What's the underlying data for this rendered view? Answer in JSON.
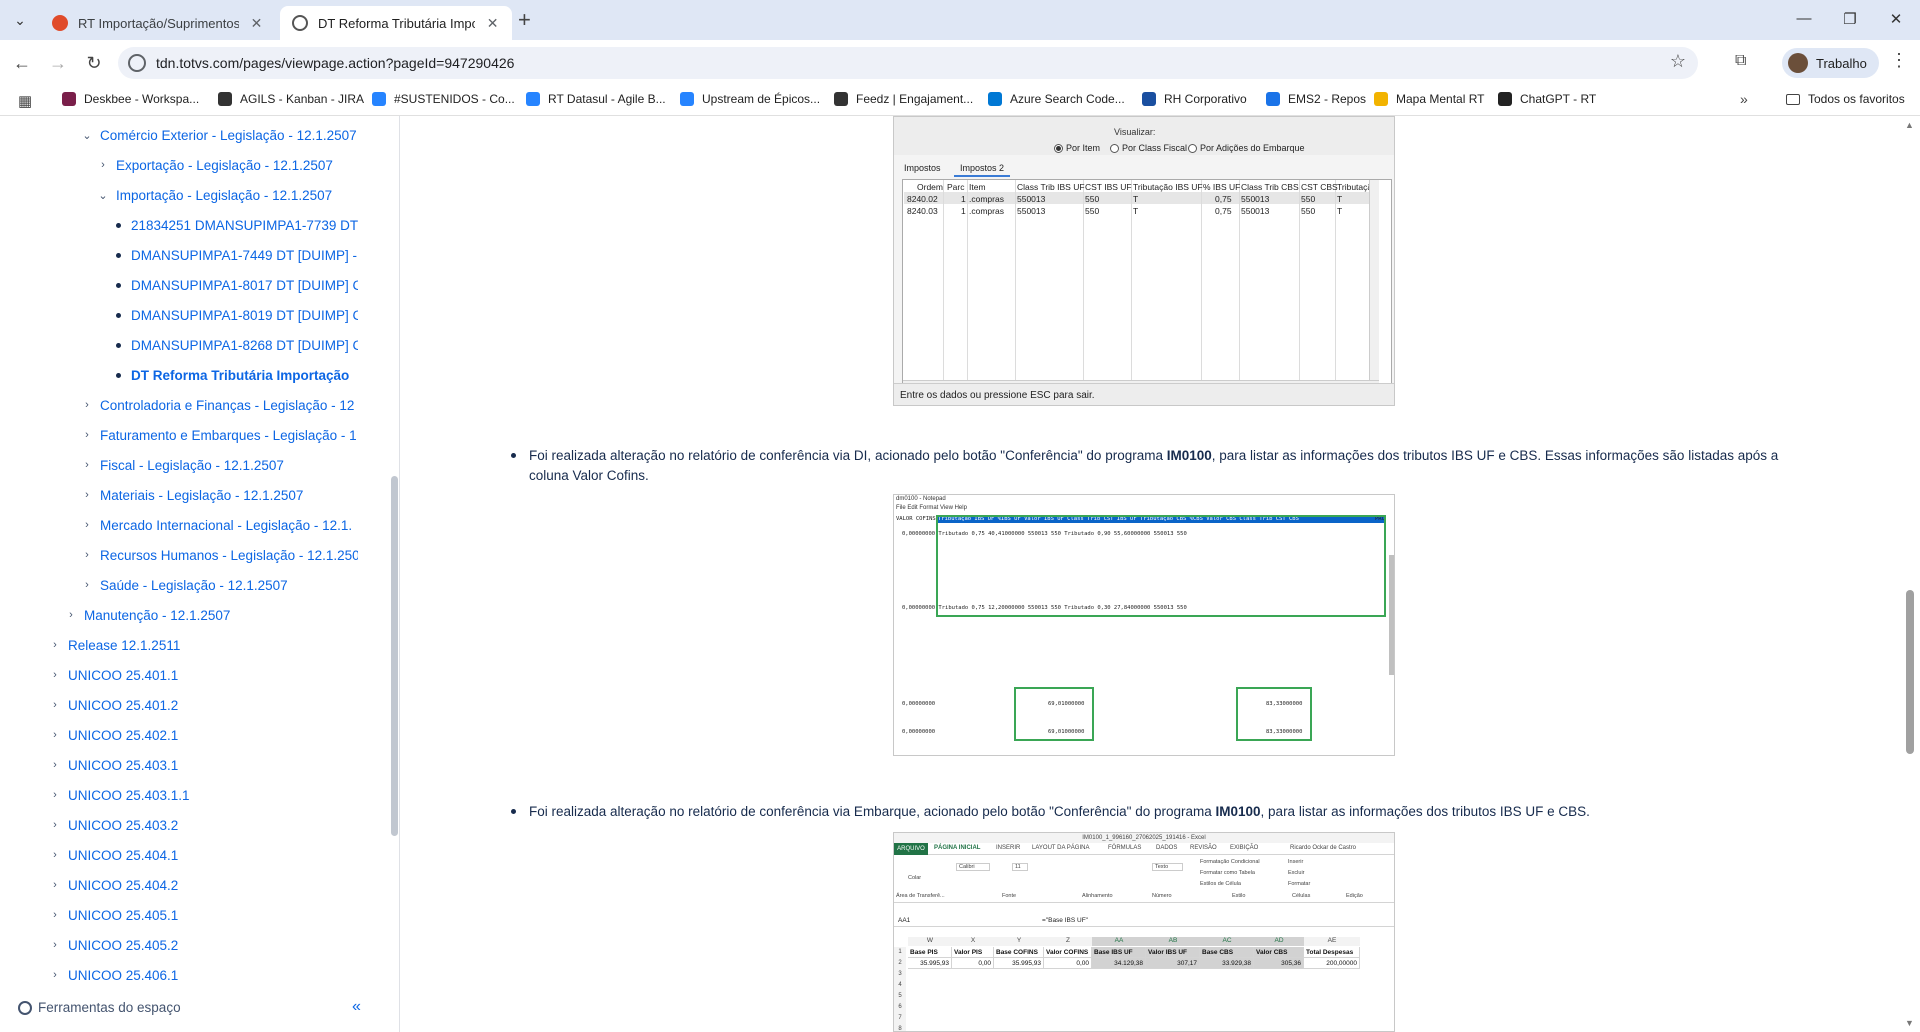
{
  "browser": {
    "tabs": [
      {
        "title": "RT Importação/Suprimentos - C",
        "active": false
      },
      {
        "title": "DT Reforma Tributária Importaç",
        "active": true
      }
    ],
    "url": "tdn.totvs.com/pages/viewpage.action?pageId=947290426",
    "profile_label": "Trabalho",
    "bookmarks": [
      {
        "label": "Deskbee - Workspa...",
        "color": "#7a1f4a"
      },
      {
        "label": "AGILS - Kanban - JIRA",
        "color": "#333333"
      },
      {
        "label": "#SUSTENIDOS - Co...",
        "color": "#2684ff"
      },
      {
        "label": "RT Datasul - Agile B...",
        "color": "#2684ff"
      },
      {
        "label": "Upstream de Épicos...",
        "color": "#2684ff"
      },
      {
        "label": "Feedz | Engajament...",
        "color": "#333333"
      },
      {
        "label": "Azure Search Code...",
        "color": "#0078d4"
      },
      {
        "label": "RH Corporativo",
        "color": "#1a4fa0"
      },
      {
        "label": "EMS2 - Repos",
        "color": "#1a73e8"
      },
      {
        "label": "Mapa Mental RT",
        "color": "#f2b300"
      },
      {
        "label": "ChatGPT - RT",
        "color": "#222222"
      }
    ],
    "all_bookmarks_label": "Todos os favoritos"
  },
  "sidebar": {
    "items": [
      {
        "label": "Comércio Exterior - Legislação - 12.1.2507",
        "level": 3,
        "type": "expanded"
      },
      {
        "label": "Exportação - Legislação - 12.1.2507",
        "level": 4,
        "type": "collapsed"
      },
      {
        "label": "Importação - Legislação - 12.1.2507",
        "level": 4,
        "type": "expanded"
      },
      {
        "label": "21834251 DMANSUPIMPA1-7739 DT",
        "level": 5,
        "type": "leaf"
      },
      {
        "label": "DMANSUPIMPA1-7449 DT [DUIMP] -",
        "level": 5,
        "type": "leaf"
      },
      {
        "label": "DMANSUPIMPA1-8017 DT [DUIMP] C",
        "level": 5,
        "type": "leaf"
      },
      {
        "label": "DMANSUPIMPA1-8019 DT [DUIMP] C",
        "level": 5,
        "type": "leaf"
      },
      {
        "label": "DMANSUPIMPA1-8268 DT [DUIMP] C",
        "level": 5,
        "type": "leaf"
      },
      {
        "label": "DT Reforma Tributária Importação",
        "level": 5,
        "type": "current"
      },
      {
        "label": "Controladoria e Finanças - Legislação - 12",
        "level": 3,
        "type": "collapsed"
      },
      {
        "label": "Faturamento e Embarques - Legislação - 1",
        "level": 3,
        "type": "collapsed"
      },
      {
        "label": "Fiscal - Legislação - 12.1.2507",
        "level": 3,
        "type": "collapsed"
      },
      {
        "label": "Materiais - Legislação - 12.1.2507",
        "level": 3,
        "type": "collapsed"
      },
      {
        "label": "Mercado Internacional - Legislação - 12.1.",
        "level": 3,
        "type": "collapsed"
      },
      {
        "label": "Recursos Humanos - Legislação - 12.1.250",
        "level": 3,
        "type": "collapsed"
      },
      {
        "label": "Saúde - Legislação - 12.1.2507",
        "level": 3,
        "type": "collapsed"
      },
      {
        "label": "Manutenção - 12.1.2507",
        "level": 2,
        "type": "collapsed"
      },
      {
        "label": "Release 12.1.2511",
        "level": 1,
        "type": "collapsed"
      },
      {
        "label": "UNICOO 25.401.1",
        "level": 1,
        "type": "collapsed"
      },
      {
        "label": "UNICOO 25.401.2",
        "level": 1,
        "type": "collapsed"
      },
      {
        "label": "UNICOO 25.402.1",
        "level": 1,
        "type": "collapsed"
      },
      {
        "label": "UNICOO 25.403.1",
        "level": 1,
        "type": "collapsed"
      },
      {
        "label": "UNICOO 25.403.1.1",
        "level": 1,
        "type": "collapsed"
      },
      {
        "label": "UNICOO 25.403.2",
        "level": 1,
        "type": "collapsed"
      },
      {
        "label": "UNICOO 25.404.1",
        "level": 1,
        "type": "collapsed"
      },
      {
        "label": "UNICOO 25.404.2",
        "level": 1,
        "type": "collapsed"
      },
      {
        "label": "UNICOO 25.405.1",
        "level": 1,
        "type": "collapsed"
      },
      {
        "label": "UNICOO 25.405.2",
        "level": 1,
        "type": "collapsed"
      },
      {
        "label": "UNICOO 25.406.1",
        "level": 1,
        "type": "collapsed"
      }
    ],
    "space_tools_label": "Ferramentas do espaço"
  },
  "content": {
    "screenshot1": {
      "visualizar_label": "Visualizar:",
      "radios": [
        "Por Item",
        "Por Class Fiscal",
        "Por Adições do Embarque"
      ],
      "tabs": [
        "Impostos",
        "Impostos 2"
      ],
      "columns": [
        "Ordem",
        "Parc",
        "Item",
        "Class Trib IBS UF",
        "CST IBS UF",
        "Tributação IBS UF",
        "% IBS UF",
        "Class Trib CBS",
        "CST CBS",
        "Tributaçã"
      ],
      "rows": [
        [
          "8240.02",
          "1",
          ".compras",
          "550013",
          "550",
          "T",
          "0,75",
          "550013",
          "550",
          "T"
        ],
        [
          "8240.03",
          "1",
          ".compras",
          "550013",
          "550",
          "T",
          "0,75",
          "550013",
          "550",
          "T"
        ]
      ],
      "status": "Entre os dados ou pressione ESC para sair."
    },
    "bullet1": {
      "pre": "Foi realizada alteração no relatório de conferência via DI, acionado pelo botão \"Conferência\" do programa ",
      "bold": "IM0100",
      "post": ", para listar as informações dos tributos IBS UF e CBS. Essas informações são listadas após a coluna Valor Cofins."
    },
    "screenshot2": {
      "window_title": "dm0100 - Notepad",
      "menu": "File  Edit  Format  View  Help",
      "header_left": "VALOR COFINS",
      "header_right": "PRO",
      "highlight": "Tributação IBS UF  %IBS UF    Valor IBS UF Class Trib CST IBS UF Tributação CBS  %CBS          Valor CBS Class Trib CST CBS",
      "row1": "0,00000000 Tributado      0,75      40,41000000 550013       550     Tributado    0,90      55,60000000 550013       550",
      "row2": "0,00000000 Tributado      0,75      12,20000000 550013       550     Tributado    0,30      27,84000000 550013       550",
      "totals_left": "0,00000000",
      "totals_mid": "69,01000000",
      "totals_right": "83,33000000"
    },
    "bullet2": {
      "pre": "Foi realizada alteração no relatório de conferência via Embarque, acionado pelo botão \"Conferência\" do programa ",
      "bold": "IM0100",
      "post": ", para listar as informações dos tributos IBS UF e CBS."
    },
    "screenshot3": {
      "title": "IM0100_1_996160_27062025_191416 - Excel",
      "tabs": [
        "ARQUIVO",
        "PÁGINA INICIAL",
        "INSERIR",
        "LAYOUT DA PÁGINA",
        "FÓRMULAS",
        "DADOS",
        "REVISÃO",
        "EXIBIÇÃO"
      ],
      "user": "Ricardo Ockar de Castro",
      "font_name": "Calibri",
      "font_size": "11",
      "cell_ref": "AA1",
      "formula": "=\"Base IBS UF\"",
      "ribbon_items": [
        "Colar",
        "Texto",
        "Formatação Condicional",
        "Formatar como Tabela",
        "Estilos de Célula",
        "Inserir",
        "Excluir",
        "Formatar",
        "Área de Transferê...",
        "Fonte",
        "Alinhamento",
        "Número",
        "Estilo",
        "Células",
        "Edição"
      ],
      "col_letters": [
        "W",
        "X",
        "Y",
        "Z",
        "AA",
        "AB",
        "AC",
        "AD",
        "AE"
      ],
      "headers": [
        "Base PIS",
        "Valor PIS",
        "Base COFINS",
        "Valor COFINS",
        "Base IBS UF",
        "Valor IBS UF",
        "Base CBS",
        "Valor CBS",
        "Total Despesas"
      ],
      "values": [
        "35.995,93",
        "0,00",
        "35.995,93",
        "0,00",
        "34.129,38",
        "307,17",
        "33.929,38",
        "305,36",
        "200,00000"
      ],
      "row_numbers": [
        "1",
        "2",
        "3",
        "4",
        "5",
        "6",
        "7",
        "8"
      ]
    }
  }
}
